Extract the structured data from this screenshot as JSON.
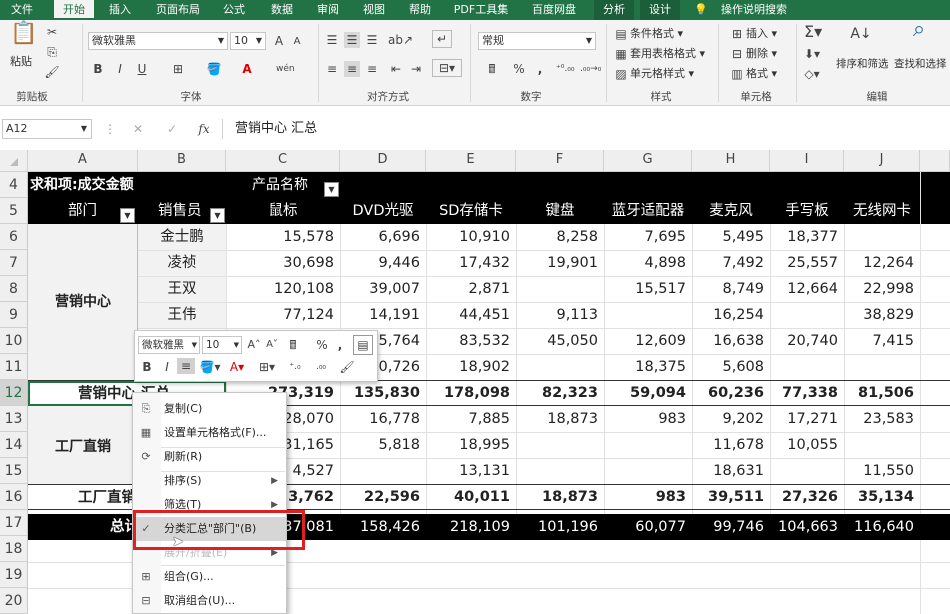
{
  "tabs": [
    "文件",
    "开始",
    "插入",
    "页面布局",
    "公式",
    "数据",
    "审阅",
    "视图",
    "帮助",
    "PDF工具集",
    "百度网盘",
    "分析",
    "设计",
    "操作说明搜索"
  ],
  "ribbon": {
    "clipboard": {
      "paste": "粘贴",
      "label": "剪贴板"
    },
    "font": {
      "name": "微软雅黑",
      "size": "10",
      "bold": "B",
      "italic": "I",
      "underline": "U",
      "grow": "A",
      "shrink": "A",
      "label": "字体"
    },
    "align": {
      "label": "对齐方式"
    },
    "number": {
      "format": "常规",
      "percent": "%",
      "comma": ",",
      "label": "数字"
    },
    "styles": {
      "cond": "条件格式",
      "table": "套用表格格式",
      "cell": "单元格样式",
      "label": "样式"
    },
    "cells": {
      "insert": "插入",
      "delete": "删除",
      "format": "格式",
      "label": "单元格"
    },
    "edit": {
      "sort": "排序和筛选",
      "find": "查找和选择",
      "label": "编辑"
    }
  },
  "formula": {
    "namebox": "A12",
    "fx": "fx",
    "cancel": "✕",
    "confirm": "✓",
    "content": "营销中心 汇总"
  },
  "columns": [
    "A",
    "B",
    "C",
    "D",
    "E",
    "F",
    "G",
    "H",
    "I",
    "J"
  ],
  "rows": [
    "4",
    "5",
    "6",
    "7",
    "8",
    "9",
    "10",
    "11",
    "12",
    "13",
    "14",
    "15",
    "16",
    "17",
    "18",
    "19",
    "20"
  ],
  "pivot": {
    "r4a": "求和项:成交金额",
    "r4c": "产品名称",
    "dept": "部门",
    "seller": "销售员",
    "products": [
      "鼠标",
      "DVD光驱",
      "SD存储卡",
      "键盘",
      "蓝牙适配器",
      "麦克风",
      "手写板",
      "无线网卡"
    ],
    "group1": "营销中心",
    "group2": "工厂直销",
    "sub1": "营销中心 汇总",
    "sub2": "工厂直销 汇总",
    "total": "总计",
    "sellers": [
      "金士鹏",
      "凌祯",
      "王双",
      "王伟"
    ],
    "data": [
      [
        "15,578",
        "6,696",
        "10,910",
        "8,258",
        "7,695",
        "5,495",
        "18,377",
        ""
      ],
      [
        "30,698",
        "9,446",
        "17,432",
        "19,901",
        "4,898",
        "7,492",
        "25,557",
        "12,264"
      ],
      [
        "120,108",
        "39,007",
        "2,871",
        "",
        "15,517",
        "8,749",
        "12,664",
        "22,998"
      ],
      [
        "77,124",
        "14,191",
        "44,451",
        "9,113",
        "",
        "16,254",
        "",
        "38,829"
      ],
      [
        "",
        "5,764",
        "83,532",
        "45,050",
        "12,609",
        "16,638",
        "20,740",
        "7,415"
      ],
      [
        "",
        "0,726",
        "18,902",
        "",
        "18,375",
        "5,608",
        "",
        ""
      ],
      [
        "273,319",
        "135,830",
        "178,098",
        "82,323",
        "59,094",
        "60,236",
        "77,338",
        "81,506"
      ],
      [
        "28,070",
        "16,778",
        "7,885",
        "18,873",
        "983",
        "9,202",
        "17,271",
        "23,583"
      ],
      [
        "31,165",
        "5,818",
        "18,995",
        "",
        "",
        "11,678",
        "10,055",
        ""
      ],
      [
        "4,527",
        "",
        "13,131",
        "",
        "",
        "18,631",
        "",
        "11,550"
      ],
      [
        "53,762",
        "22,596",
        "40,011",
        "18,873",
        "983",
        "39,511",
        "27,326",
        "35,134"
      ],
      [
        "37,081",
        "158,426",
        "218,109",
        "101,196",
        "60,077",
        "99,746",
        "104,663",
        "116,640"
      ]
    ]
  },
  "minitoolbar": {
    "font": "微软雅黑",
    "size": "10",
    "bold": "B",
    "italic": "I",
    "percent": "%",
    "comma": ","
  },
  "contextmenu": {
    "items": [
      "复制(C)",
      "设置单元格格式(F)...",
      "刷新(R)",
      "排序(S)",
      "筛选(T)",
      "分类汇总\"部门\"(B)",
      "展开/折叠(E)",
      "组合(G)...",
      "取消组合(U)..."
    ]
  },
  "colors": {
    "excel_green": "#217346",
    "highlight_red": "#e02020",
    "black": "#000000"
  }
}
